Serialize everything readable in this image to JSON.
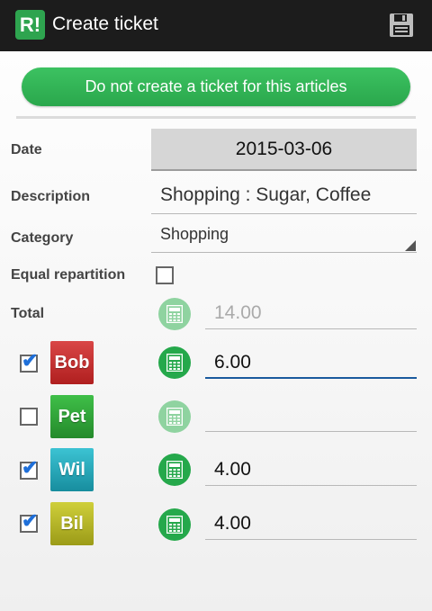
{
  "appbar": {
    "logo_text": "R!",
    "title": "Create ticket",
    "save_icon": "save-icon",
    "bg_color": "#1c1c1c"
  },
  "banner_button": {
    "label": "Do not create a ticket for this articles",
    "color": "#2ea44f"
  },
  "form": {
    "date_label": "Date",
    "date_value": "2015-03-06",
    "description_label": "Description",
    "description_value": "Shopping : Sugar, Coffee",
    "category_label": "Category",
    "category_value": "Shopping",
    "equal_label": "Equal repartition",
    "equal_checked": false,
    "total_label": "Total",
    "total_value": "14.00"
  },
  "participants": [
    {
      "name": "Bob",
      "checked": true,
      "amount": "6.00",
      "color": "#c62828"
    },
    {
      "name": "Pet",
      "checked": false,
      "amount": "",
      "color": "#2e9e36"
    },
    {
      "name": "Wil",
      "checked": true,
      "amount": "4.00",
      "color": "#1fa3b6"
    },
    {
      "name": "Bil",
      "checked": true,
      "amount": "4.00",
      "color": "#b5b524"
    }
  ]
}
